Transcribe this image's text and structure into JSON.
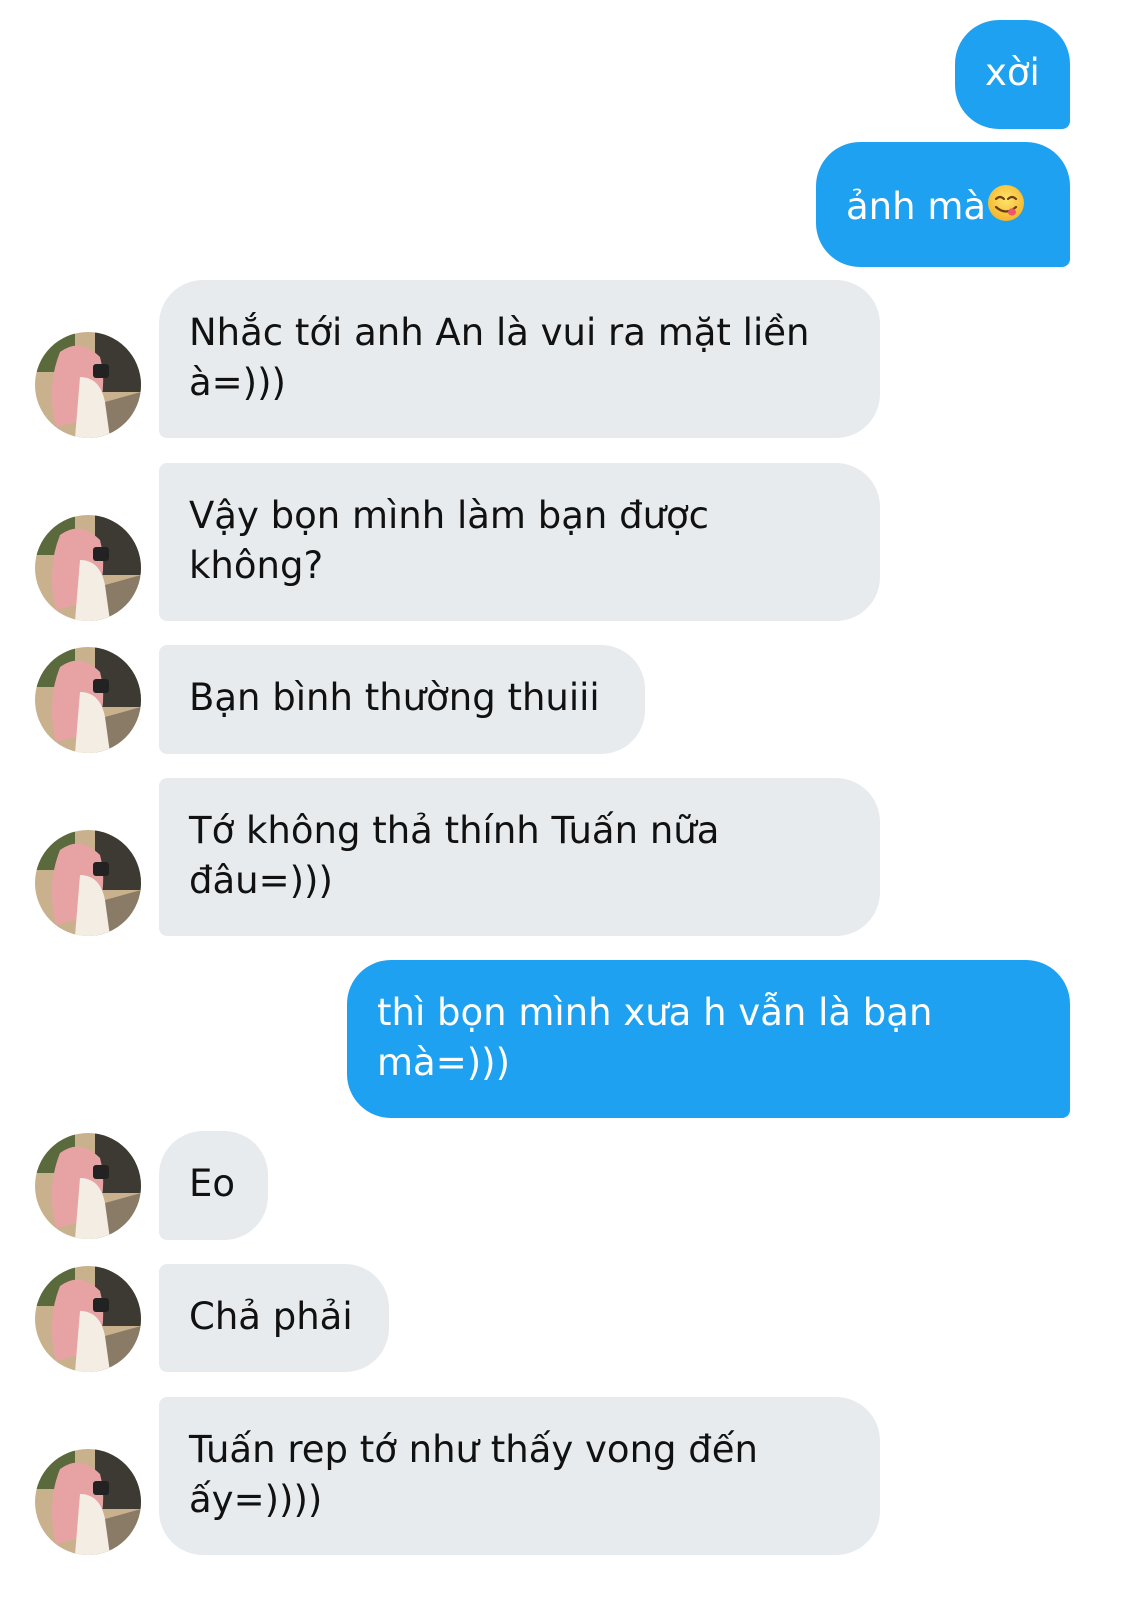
{
  "conversation": {
    "messages": [
      {
        "id": "m1",
        "side": "out",
        "lines": [
          "xời"
        ]
      },
      {
        "id": "m2",
        "side": "out",
        "lines": [
          "ảnh mà"
        ],
        "emoji": "face-savoring-food-emoji"
      },
      {
        "id": "m3",
        "side": "in",
        "lines": [
          "Nhắc tới anh An là vui ra mặt liền",
          "à=)))"
        ]
      },
      {
        "id": "m4",
        "side": "in",
        "lines": [
          "Vậy bọn mình làm bạn được",
          "không?"
        ]
      },
      {
        "id": "m5",
        "side": "in",
        "lines": [
          "Bạn bình thường thuiii"
        ]
      },
      {
        "id": "m6",
        "side": "in",
        "lines": [
          "Tớ không thả thính Tuấn nữa",
          "đâu=)))"
        ]
      },
      {
        "id": "m7",
        "side": "out",
        "lines": [
          "thì bọn mình xưa h vẫn là bạn",
          "mà=)))"
        ]
      },
      {
        "id": "m8",
        "side": "in",
        "lines": [
          "Eo"
        ]
      },
      {
        "id": "m9",
        "side": "in",
        "lines": [
          "Chả phải"
        ]
      },
      {
        "id": "m10",
        "side": "in",
        "lines": [
          "Tuấn rep tớ như thấy vong đến",
          "ấy=))))"
        ]
      }
    ]
  },
  "colors": {
    "outgoing_bubble": "#1fa1f1",
    "incoming_bubble": "#e7ebee",
    "incoming_text": "#111111",
    "outgoing_text": "#ffffff"
  },
  "icons": {
    "avatar": "contact-avatar-photo",
    "emoji": "face-savoring-food-emoji"
  }
}
